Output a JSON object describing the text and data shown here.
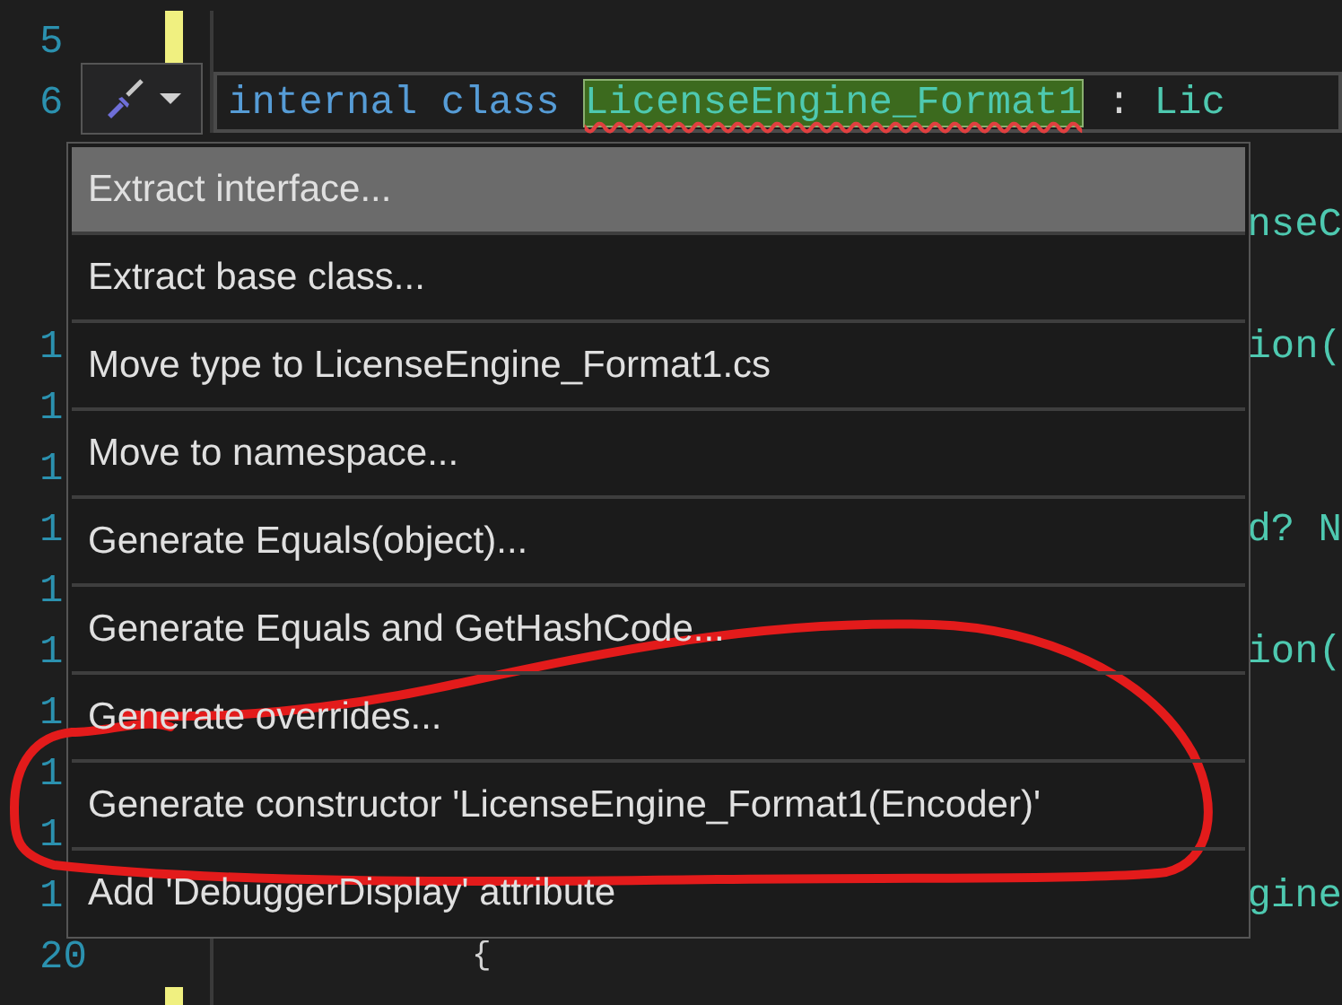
{
  "editor": {
    "lines": [
      {
        "number": "5",
        "changed": true
      },
      {
        "number": "6",
        "current": true,
        "tokens": [
          {
            "kind": "keyword",
            "text": "internal class"
          },
          {
            "kind": "highlight",
            "text": "LicenseEngine_Format1"
          },
          {
            "kind": "plain",
            "text": ":"
          },
          {
            "kind": "type",
            "text": "Lic"
          }
        ]
      },
      {
        "tail": "nseC"
      },
      {
        "number": "1",
        "tail": "ion("
      },
      {
        "number": "1"
      },
      {
        "number": "1"
      },
      {
        "number": "1",
        "tail": "d? N"
      },
      {
        "number": "1"
      },
      {
        "number": "1",
        "tail": "ion("
      },
      {
        "number": "1"
      },
      {
        "number": "1"
      },
      {
        "number": "1"
      },
      {
        "number": "1",
        "tail": "gine"
      },
      {
        "number": "20",
        "tokens": [
          {
            "kind": "brace",
            "text": "{"
          }
        ]
      },
      {
        "changed": true
      }
    ]
  },
  "quick_actions": {
    "items": [
      {
        "label": "Extract interface...",
        "selected": true
      },
      {
        "label": "Extract base class...",
        "selected": false
      },
      {
        "label": "Move type to LicenseEngine_Format1.cs",
        "selected": false
      },
      {
        "label": "Move to namespace...",
        "selected": false
      },
      {
        "label": "Generate Equals(object)...",
        "selected": false
      },
      {
        "label": "Generate Equals and GetHashCode...",
        "selected": false
      },
      {
        "label": "Generate overrides...",
        "selected": false
      },
      {
        "label": "Generate constructor 'LicenseEngine_Format1(Encoder)'",
        "selected": false
      },
      {
        "label": "Add 'DebuggerDisplay' attribute",
        "selected": false
      }
    ]
  }
}
